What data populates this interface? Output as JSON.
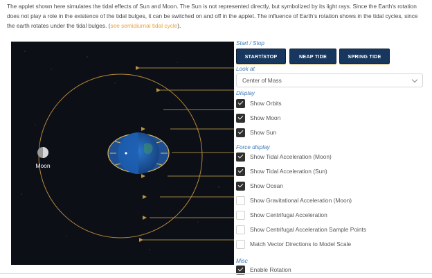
{
  "intro": {
    "text": "The applet shown here simulates the tidal effects of Sun and Moon. The Sun is not represented directly, but symbolized by its light rays. Since the Earth's rotation does not play a role in the existence of the tidal bulges, it can be switched on and off in the applet. The influence of Earth's rotation shows in the tidal cycles, since the earth rotates under the tidal bulges. (",
    "link": "see semidiurnal tidal cycle",
    "after": ")."
  },
  "sim": {
    "moon_label": "Moon"
  },
  "controls": {
    "start_stop_section": "Start / Stop",
    "buttons": {
      "start_stop": "START/STOP",
      "neap": "NEAP TIDE",
      "spring": "SPRING TIDE"
    },
    "look_at_section": "Look at",
    "look_at_value": "Center of Mass",
    "display_section": "Display",
    "display": [
      {
        "label": "Show Orbits",
        "checked": true
      },
      {
        "label": "Show Moon",
        "checked": true
      },
      {
        "label": "Show Sun",
        "checked": true
      }
    ],
    "force_section": "Force display",
    "force": [
      {
        "label": "Show Tidal Acceleration (Moon)",
        "checked": true
      },
      {
        "label": "Show Tidal Acceleration (Sun)",
        "checked": true
      },
      {
        "label": "Show Ocean",
        "checked": true
      },
      {
        "label": "Show Gravitational Acceleration (Moon)",
        "checked": false
      },
      {
        "label": "Show Centrifugal Acceleration",
        "checked": false
      },
      {
        "label": "Show Centrifugal Acceleration Sample Points",
        "checked": false
      },
      {
        "label": "Match Vector Directions to Model Scale",
        "checked": false
      }
    ],
    "misc_section": "Misc",
    "misc": [
      {
        "label": "Enable Rotation",
        "checked": true
      }
    ]
  },
  "colors": {
    "accent": "#e8a33d",
    "section": "#3b78b8",
    "button": "#17375e",
    "orbit": "#b88a3a",
    "ocean": "#2f73c8"
  }
}
